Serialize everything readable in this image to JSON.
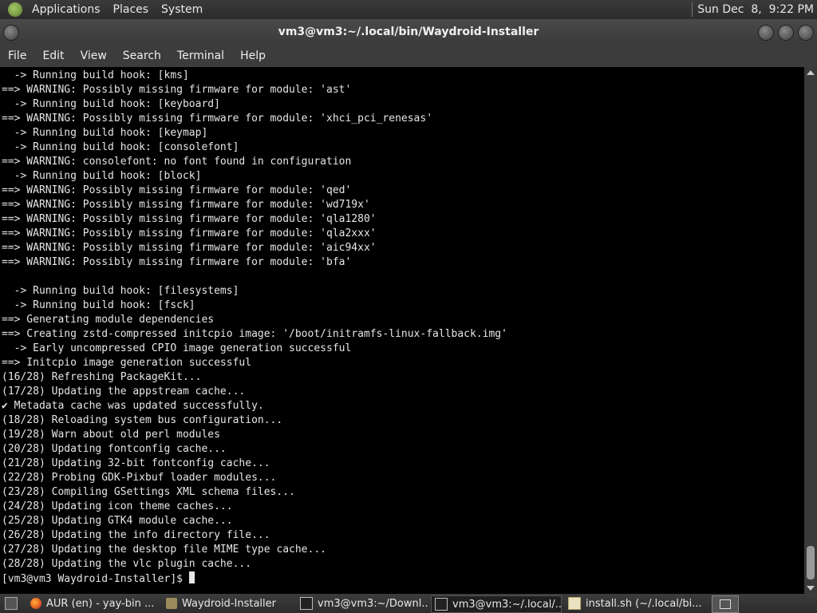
{
  "top_panel": {
    "menus": [
      "Applications",
      "Places",
      "System"
    ],
    "clock": "Sun Dec  8,  9:22 PM"
  },
  "window": {
    "title": "vm3@vm3:~/.local/bin/Waydroid-Installer",
    "menu": [
      "File",
      "Edit",
      "View",
      "Search",
      "Terminal",
      "Help"
    ]
  },
  "terminal": {
    "lines": [
      "  -> Running build hook: [kms]",
      "==> WARNING: Possibly missing firmware for module: 'ast'",
      "  -> Running build hook: [keyboard]",
      "==> WARNING: Possibly missing firmware for module: 'xhci_pci_renesas'",
      "  -> Running build hook: [keymap]",
      "  -> Running build hook: [consolefont]",
      "==> WARNING: consolefont: no font found in configuration",
      "  -> Running build hook: [block]",
      "==> WARNING: Possibly missing firmware for module: 'qed'",
      "==> WARNING: Possibly missing firmware for module: 'wd719x'",
      "==> WARNING: Possibly missing firmware for module: 'qla1280'",
      "==> WARNING: Possibly missing firmware for module: 'qla2xxx'",
      "==> WARNING: Possibly missing firmware for module: 'aic94xx'",
      "==> WARNING: Possibly missing firmware for module: 'bfa'",
      "",
      "  -> Running build hook: [filesystems]",
      "  -> Running build hook: [fsck]",
      "==> Generating module dependencies",
      "==> Creating zstd-compressed initcpio image: '/boot/initramfs-linux-fallback.img'",
      "  -> Early uncompressed CPIO image generation successful",
      "==> Initcpio image generation successful",
      "(16/28) Refreshing PackageKit...",
      "(17/28) Updating the appstream cache...",
      "✔ Metadata cache was updated successfully.",
      "(18/28) Reloading system bus configuration...",
      "(19/28) Warn about old perl modules",
      "(20/28) Updating fontconfig cache...",
      "(21/28) Updating 32-bit fontconfig cache...",
      "(22/28) Probing GDK-Pixbuf loader modules...",
      "(23/28) Compiling GSettings XML schema files...",
      "(24/28) Updating icon theme caches...",
      "(25/28) Updating GTK4 module cache...",
      "(26/28) Updating the info directory file...",
      "(27/28) Updating the desktop file MIME type cache...",
      "(28/28) Updating the vlc plugin cache..."
    ],
    "prompt": "[vm3@vm3 Waydroid-Installer]$ "
  },
  "taskbar": {
    "tasks": [
      {
        "label": "AUR (en) - yay-bin ...",
        "icon": "firefox-icon"
      },
      {
        "label": "Waydroid-Installer",
        "icon": "folder-icon"
      },
      {
        "label": "vm3@vm3:~/Downl...",
        "icon": "terminal-icon"
      },
      {
        "label": "vm3@vm3:~/.local/...",
        "icon": "terminal-icon"
      },
      {
        "label": "install.sh (~/.local/bi...",
        "icon": "text-editor-icon"
      }
    ]
  }
}
